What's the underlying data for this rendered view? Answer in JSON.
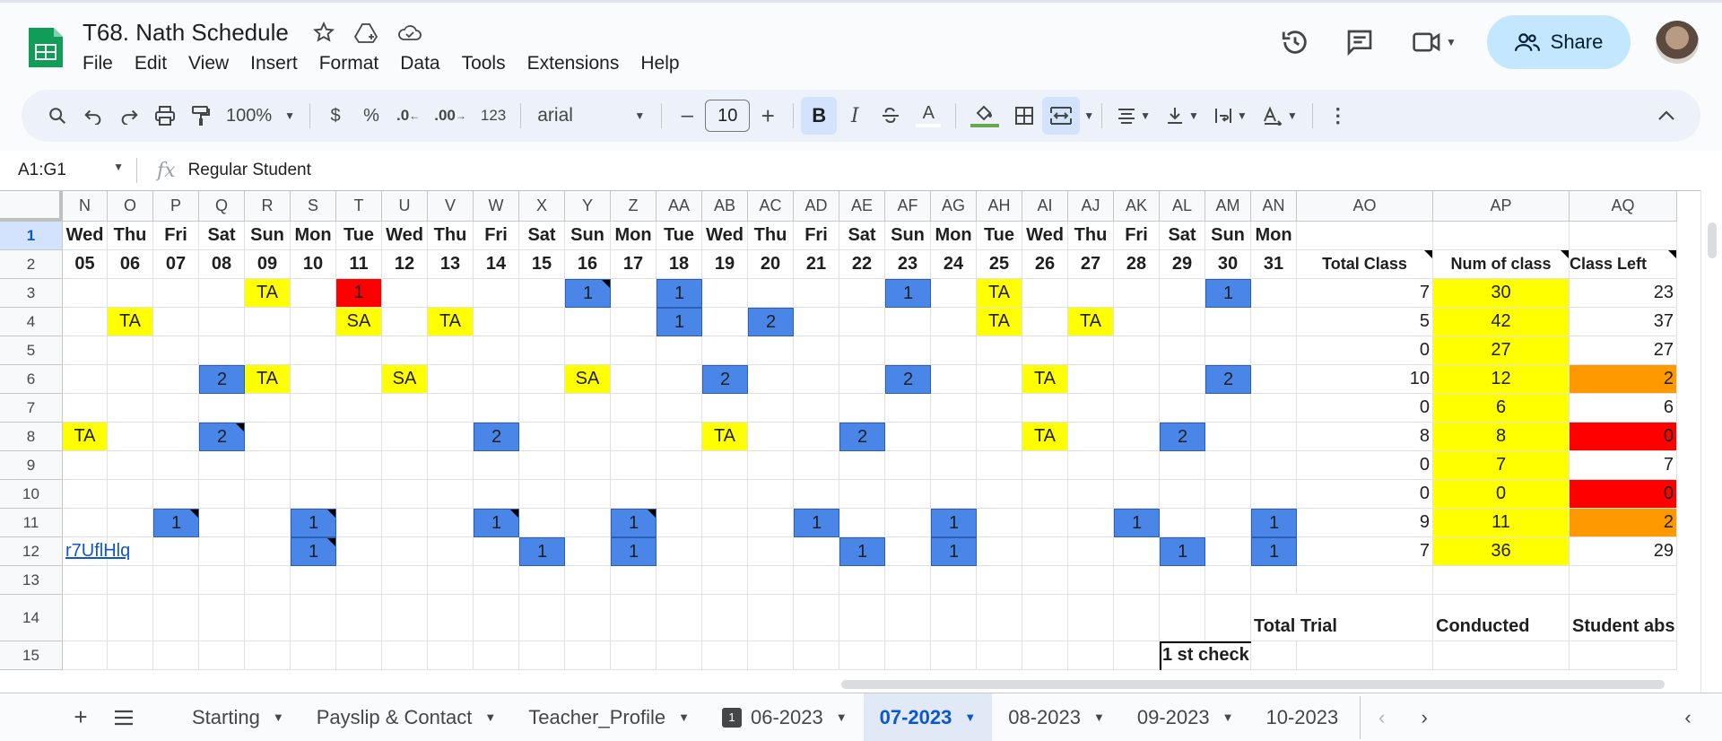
{
  "app": {
    "doc_title": "T68. Nath Schedule",
    "menu": [
      "File",
      "Edit",
      "View",
      "Insert",
      "Format",
      "Data",
      "Tools",
      "Extensions",
      "Help"
    ],
    "share_label": "Share",
    "brand_color": "#0f9d58"
  },
  "toolbar": {
    "zoom": "100%",
    "currency": "$",
    "percent": "%",
    "dec_decrease": ".0",
    "dec_increase": ".00",
    "number_format": "123",
    "font": "arial",
    "font_size": "10",
    "minus": "–",
    "plus": "+",
    "bold": "B",
    "italic": "I",
    "text_color": "A"
  },
  "formula_bar": {
    "name_box": "A1:G1",
    "fx": "fx",
    "value": "Regular Student"
  },
  "grid": {
    "columns": [
      "N",
      "O",
      "P",
      "Q",
      "R",
      "S",
      "T",
      "U",
      "V",
      "W",
      "X",
      "Y",
      "Z",
      "AA",
      "AB",
      "AC",
      "AD",
      "AE",
      "AF",
      "AG",
      "AH",
      "AI",
      "AJ",
      "AK",
      "AL",
      "AM",
      "AN",
      "AO",
      "AP",
      "AQ"
    ],
    "rows": [
      "1",
      "2",
      "3",
      "4",
      "5",
      "6",
      "7",
      "8",
      "9",
      "10",
      "11",
      "12",
      "13",
      "14",
      "15"
    ],
    "days": [
      "Wed",
      "Thu",
      "Fri",
      "Sat",
      "Sun",
      "Mon",
      "Tue",
      "Wed",
      "Thu",
      "Fri",
      "Sat",
      "Sun",
      "Mon",
      "Tue",
      "Wed",
      "Thu",
      "Fri",
      "Sat",
      "Sun",
      "Mon",
      "Tue",
      "Wed",
      "Thu",
      "Fri",
      "Sat",
      "Sun",
      "Mon"
    ],
    "dates": [
      "05",
      "06",
      "07",
      "08",
      "09",
      "10",
      "11",
      "12",
      "13",
      "14",
      "15",
      "16",
      "17",
      "18",
      "19",
      "20",
      "21",
      "22",
      "23",
      "24",
      "25",
      "26",
      "27",
      "28",
      "29",
      "30",
      "31"
    ],
    "summary_headers": [
      "Total Class",
      "Num of class",
      "Class Left"
    ],
    "summary": [
      {
        "total": "7",
        "num": "30",
        "left": "23",
        "left_color": ""
      },
      {
        "total": "5",
        "num": "42",
        "left": "37",
        "left_color": ""
      },
      {
        "total": "0",
        "num": "27",
        "left": "27",
        "left_color": ""
      },
      {
        "total": "10",
        "num": "12",
        "left": "2",
        "left_color": "#ff9900"
      },
      {
        "total": "0",
        "num": "6",
        "left": "6",
        "left_color": ""
      },
      {
        "total": "8",
        "num": "8",
        "left": "0",
        "left_color": "#ff0000"
      },
      {
        "total": "0",
        "num": "7",
        "left": "7",
        "left_color": ""
      },
      {
        "total": "0",
        "num": "0",
        "left": "0",
        "left_color": "#ff0000"
      },
      {
        "total": "9",
        "num": "11",
        "left": "2",
        "left_color": "#ff9900"
      },
      {
        "total": "7",
        "num": "36",
        "left": "29",
        "left_color": ""
      }
    ],
    "schedule": [
      {
        "row": 3,
        "col": "R",
        "text": "TA",
        "color": "yellow"
      },
      {
        "row": 3,
        "col": "T",
        "text": "1",
        "color": "red"
      },
      {
        "row": 3,
        "col": "Y",
        "text": "1",
        "color": "blue",
        "note": true
      },
      {
        "row": 3,
        "col": "AA",
        "text": "1",
        "color": "blue"
      },
      {
        "row": 3,
        "col": "AF",
        "text": "1",
        "color": "blue"
      },
      {
        "row": 3,
        "col": "AH",
        "text": "TA",
        "color": "yellow"
      },
      {
        "row": 3,
        "col": "AM",
        "text": "1",
        "color": "blue"
      },
      {
        "row": 4,
        "col": "O",
        "text": "TA",
        "color": "yellow"
      },
      {
        "row": 4,
        "col": "T",
        "text": "SA",
        "color": "yellow"
      },
      {
        "row": 4,
        "col": "V",
        "text": "TA",
        "color": "yellow"
      },
      {
        "row": 4,
        "col": "AA",
        "text": "1",
        "color": "blue"
      },
      {
        "row": 4,
        "col": "AC",
        "text": "2",
        "color": "blue"
      },
      {
        "row": 4,
        "col": "AH",
        "text": "TA",
        "color": "yellow"
      },
      {
        "row": 4,
        "col": "AJ",
        "text": "TA",
        "color": "yellow"
      },
      {
        "row": 6,
        "col": "Q",
        "text": "2",
        "color": "blue"
      },
      {
        "row": 6,
        "col": "R",
        "text": "TA",
        "color": "yellow"
      },
      {
        "row": 6,
        "col": "U",
        "text": "SA",
        "color": "yellow"
      },
      {
        "row": 6,
        "col": "Y",
        "text": "SA",
        "color": "yellow"
      },
      {
        "row": 6,
        "col": "AB",
        "text": "2",
        "color": "blue"
      },
      {
        "row": 6,
        "col": "AF",
        "text": "2",
        "color": "blue"
      },
      {
        "row": 6,
        "col": "AI",
        "text": "TA",
        "color": "yellow"
      },
      {
        "row": 6,
        "col": "AM",
        "text": "2",
        "color": "blue"
      },
      {
        "row": 8,
        "col": "N",
        "text": "TA",
        "color": "yellow"
      },
      {
        "row": 8,
        "col": "Q",
        "text": "2",
        "color": "blue",
        "note": true
      },
      {
        "row": 8,
        "col": "W",
        "text": "2",
        "color": "blue"
      },
      {
        "row": 8,
        "col": "AB",
        "text": "TA",
        "color": "yellow"
      },
      {
        "row": 8,
        "col": "AE",
        "text": "2",
        "color": "blue"
      },
      {
        "row": 8,
        "col": "AI",
        "text": "TA",
        "color": "yellow"
      },
      {
        "row": 8,
        "col": "AL",
        "text": "2",
        "color": "blue"
      },
      {
        "row": 11,
        "col": "P",
        "text": "1",
        "color": "blue",
        "note": true
      },
      {
        "row": 11,
        "col": "S",
        "text": "1",
        "color": "blue",
        "note": true
      },
      {
        "row": 11,
        "col": "W",
        "text": "1",
        "color": "blue",
        "note": true
      },
      {
        "row": 11,
        "col": "Z",
        "text": "1",
        "color": "blue",
        "note": true
      },
      {
        "row": 11,
        "col": "AD",
        "text": "1",
        "color": "blue"
      },
      {
        "row": 11,
        "col": "AG",
        "text": "1",
        "color": "blue"
      },
      {
        "row": 11,
        "col": "AK",
        "text": "1",
        "color": "blue"
      },
      {
        "row": 11,
        "col": "AN",
        "text": "1",
        "color": "blue"
      },
      {
        "row": 12,
        "col": "S",
        "text": "1",
        "color": "blue",
        "note": true
      },
      {
        "row": 12,
        "col": "X",
        "text": "1",
        "color": "blue"
      },
      {
        "row": 12,
        "col": "Z",
        "text": "1",
        "color": "blue"
      },
      {
        "row": 12,
        "col": "AE",
        "text": "1",
        "color": "blue"
      },
      {
        "row": 12,
        "col": "AG",
        "text": "1",
        "color": "blue"
      },
      {
        "row": 12,
        "col": "AL",
        "text": "1",
        "color": "blue"
      },
      {
        "row": 12,
        "col": "AN",
        "text": "1",
        "color": "blue"
      }
    ],
    "link_text": "r7UflHlq",
    "row14": {
      "total_trial": "Total Trial",
      "conducted": "Conducted",
      "student_abs": "Student abs"
    },
    "row15": {
      "first_check": "1 st check"
    }
  },
  "sheets": [
    {
      "label": "Starting",
      "active": false
    },
    {
      "label": "Payslip & Contact",
      "active": false
    },
    {
      "label": "Teacher_Profile",
      "active": false
    },
    {
      "label": "06-2023",
      "active": false,
      "badge": "1"
    },
    {
      "label": "07-2023",
      "active": true
    },
    {
      "label": "08-2023",
      "active": false
    },
    {
      "label": "09-2023",
      "active": false
    },
    {
      "label": "10-2023",
      "active": false
    }
  ],
  "colors": {
    "yellow": "#ffff00",
    "blue": "#4a86e8",
    "red": "#ff0000",
    "orange": "#ff9900",
    "accent": "#0b57d0",
    "share_bg": "#c2e7ff"
  }
}
